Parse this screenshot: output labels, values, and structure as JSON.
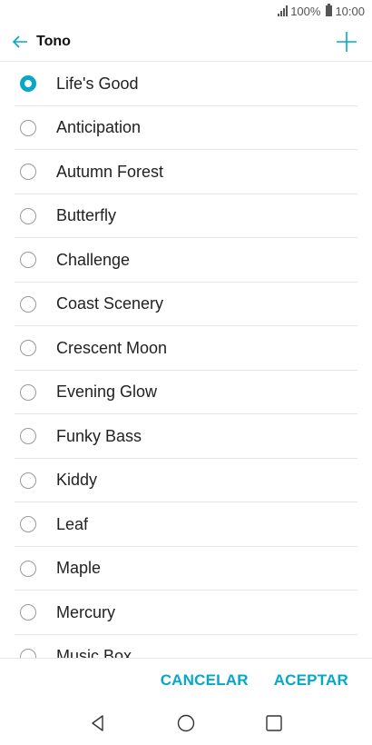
{
  "status": {
    "battery_text": "100%",
    "time": "10:00"
  },
  "header": {
    "title": "Tono",
    "back_icon": "arrow-left-icon",
    "add_icon": "plus-icon"
  },
  "accent_color": "#05a8c7",
  "ringtones": [
    {
      "label": "Life's Good",
      "selected": true
    },
    {
      "label": "Anticipation",
      "selected": false
    },
    {
      "label": "Autumn Forest",
      "selected": false
    },
    {
      "label": "Butterfly",
      "selected": false
    },
    {
      "label": "Challenge",
      "selected": false
    },
    {
      "label": "Coast Scenery",
      "selected": false
    },
    {
      "label": "Crescent Moon",
      "selected": false
    },
    {
      "label": "Evening Glow",
      "selected": false
    },
    {
      "label": "Funky Bass",
      "selected": false
    },
    {
      "label": "Kiddy",
      "selected": false
    },
    {
      "label": "Leaf",
      "selected": false
    },
    {
      "label": "Maple",
      "selected": false
    },
    {
      "label": "Mercury",
      "selected": false
    },
    {
      "label": "Music Box",
      "selected": false
    }
  ],
  "actions": {
    "cancel": "CANCELAR",
    "accept": "ACEPTAR"
  },
  "nav": {
    "back": "triangle-back-icon",
    "home": "circle-home-icon",
    "recents": "square-recents-icon"
  }
}
